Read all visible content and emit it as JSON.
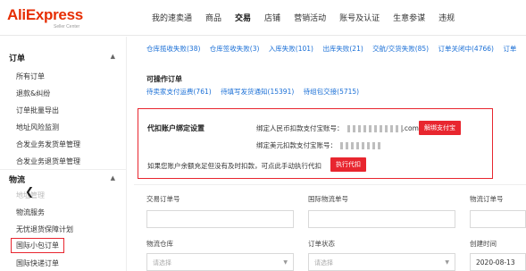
{
  "brand": {
    "name": "AliExpress",
    "subtitle": "Seller Center"
  },
  "topnav": [
    "我的速卖通",
    "商品",
    "交易",
    "店铺",
    "营销活动",
    "账号及认证",
    "生意参谋",
    "违规"
  ],
  "sidebar": {
    "order_section": "订单",
    "order_items": [
      "所有订单",
      "退款&纠纷",
      "订单批量导出",
      "地址风险监测",
      "合发业务发货单管理",
      "合发业务退货单管理"
    ],
    "logistics_section": "物流",
    "logistics_items": [
      "地址管理",
      "物流服务",
      "无忧退货保障计划",
      "国际小包订单",
      "国际快递订单"
    ]
  },
  "stats_row1": [
    "仓库揽收失败(38)",
    "仓库签收失败(3)",
    "入库失败(101)",
    "出库失败(21)",
    "交航/交货失败(85)",
    "订单关闭中(4766)",
    "订单"
  ],
  "operable": {
    "title": "可操作订单",
    "items": [
      "待卖家支付运费(761)",
      "待填写发货通知(15391)",
      "待组包交接(5715)"
    ]
  },
  "agent_pay": {
    "title": "代扣账户绑定设置",
    "rmb_label": "绑定人民币扣款支付宝账号：",
    "rmb_value_suffix": ".com",
    "usd_label": "绑定美元扣款支付宝账号：",
    "unbind_button": "解绑支付宝",
    "tip": "如果您账户余额充足但没有及时扣款，可点此手动执行代扣",
    "execute_button": "执行代扣"
  },
  "form": {
    "trade_order_label": "交易订单号",
    "intl_logistics_label": "国际物流单号",
    "logistics_order_label": "物流订单号",
    "warehouse_label": "物流仓库",
    "warehouse_placeholder": "请选择",
    "status_label": "订单状态",
    "status_placeholder": "请选择",
    "created_label": "创建时间",
    "created_value": "2020-08-13"
  },
  "colors": {
    "brand_red": "#e62e04",
    "accent_red": "#e8262f",
    "link_blue": "#1a6fd6"
  }
}
